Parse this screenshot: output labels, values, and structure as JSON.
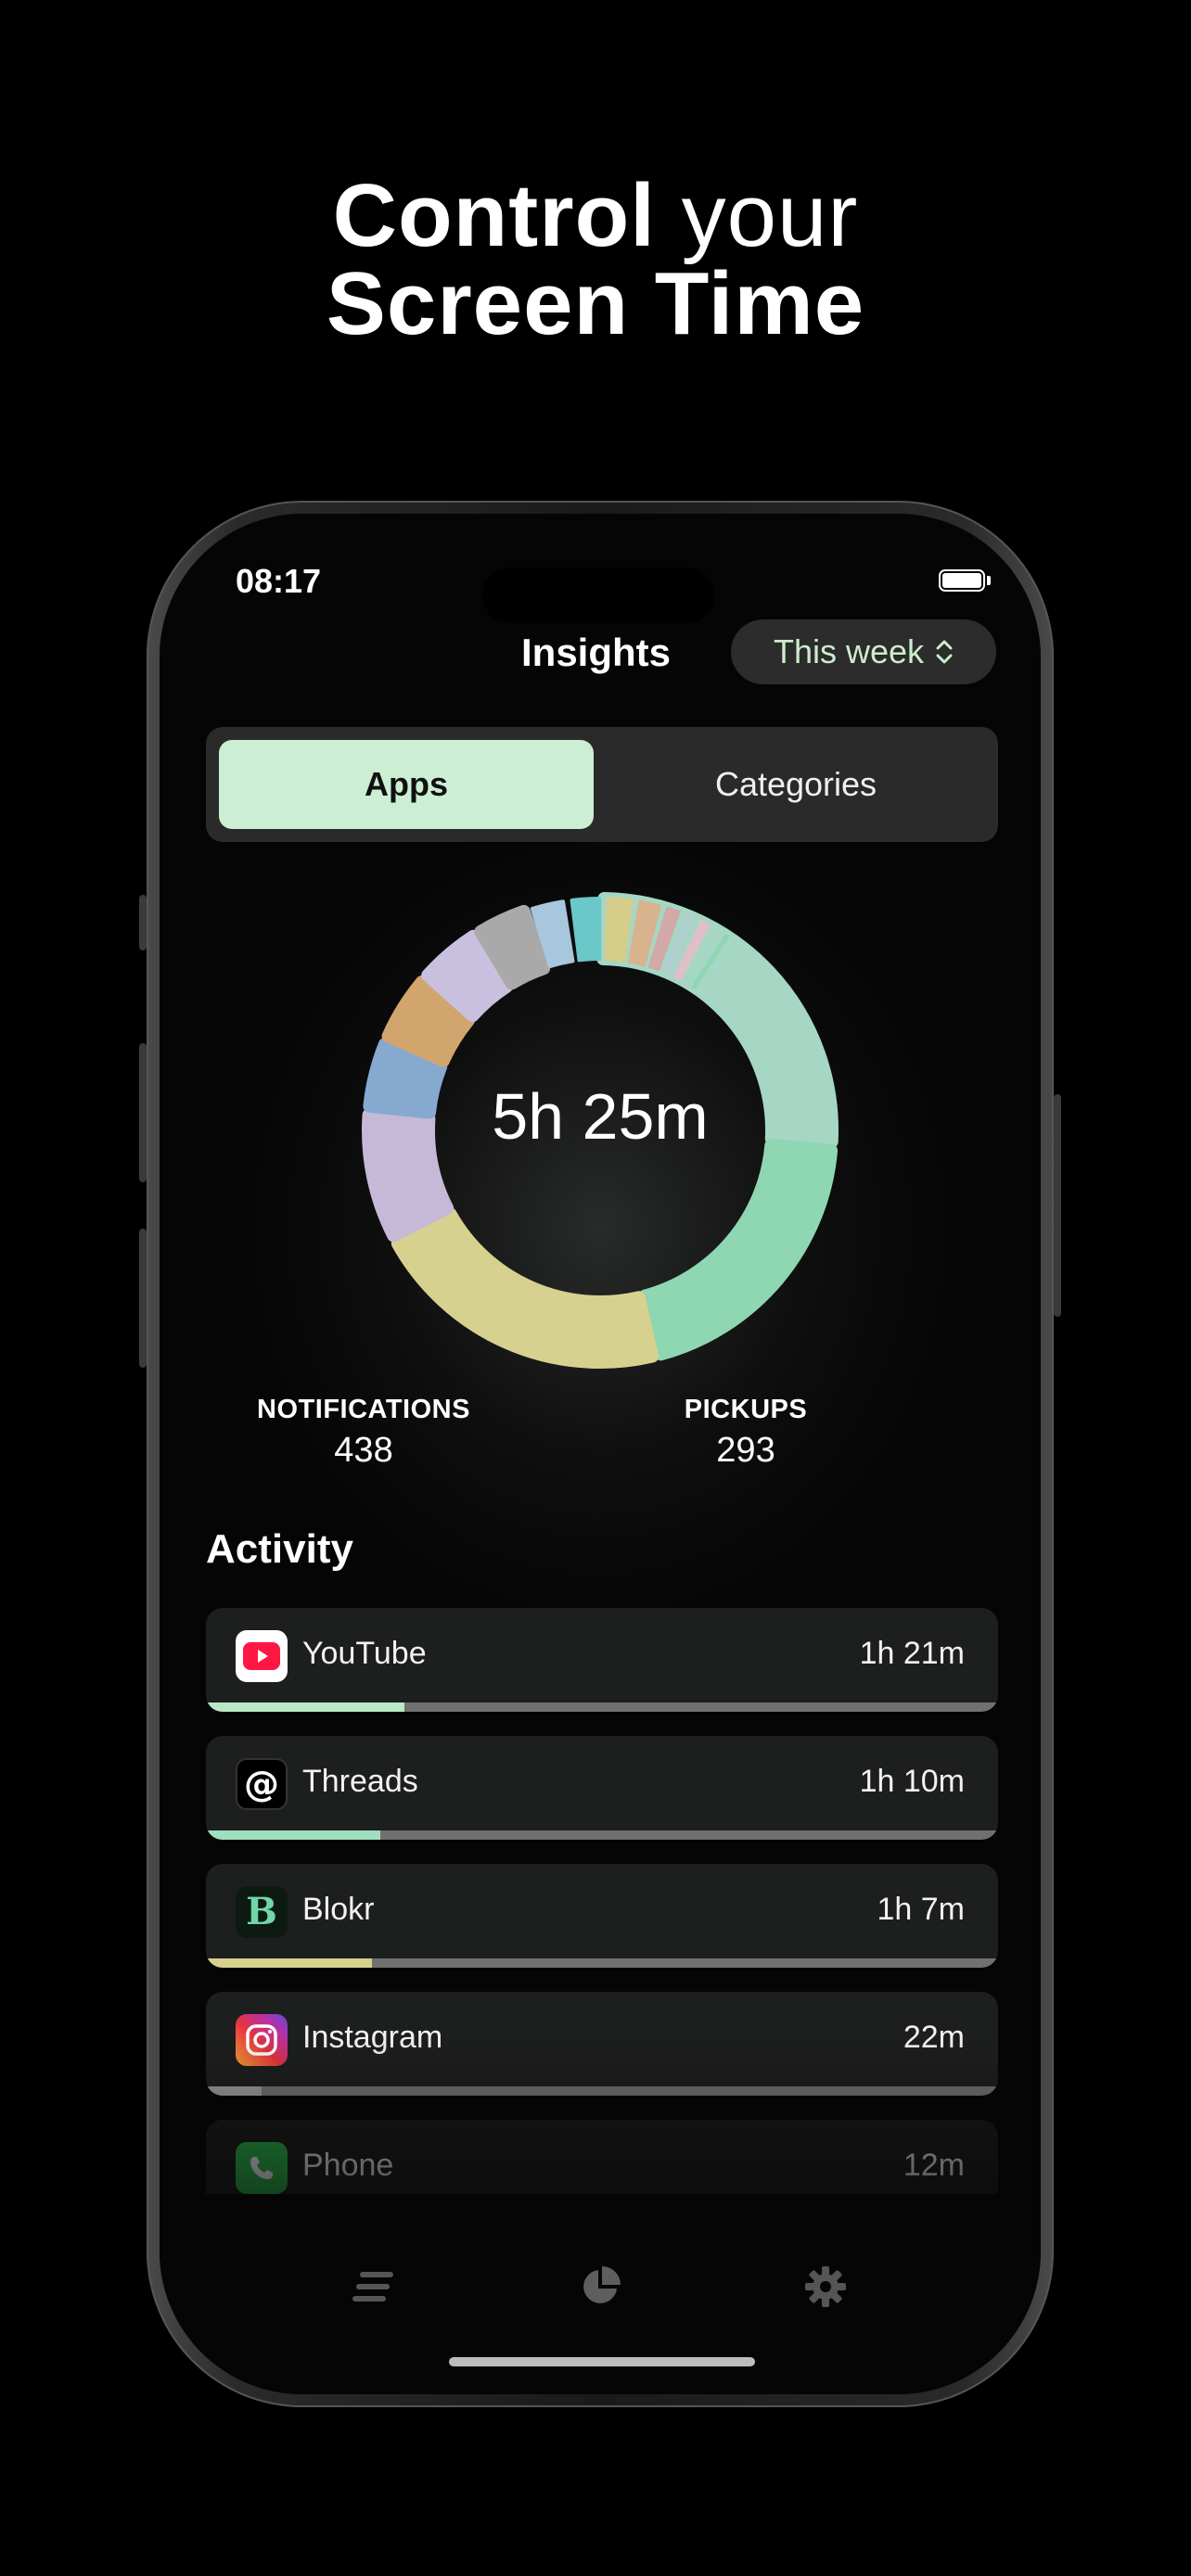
{
  "headline": {
    "line1_bold": "Control",
    "line1_light": "your",
    "line2": "Screen Time"
  },
  "status_bar": {
    "time": "08:17"
  },
  "nav": {
    "title": "Insights",
    "period": "This week"
  },
  "segmented": {
    "selected": "Apps",
    "options": [
      "Apps",
      "Categories"
    ]
  },
  "summary": {
    "total": "5h 25m",
    "notifications_label": "NOTIFICATIONS",
    "notifications_value": "438",
    "pickups_label": "PICKUPS",
    "pickups_value": "293"
  },
  "activity": {
    "title": "Activity",
    "items": [
      {
        "name": "YouTube",
        "time": "1h 21m",
        "share": 0.25,
        "bar_color": "#b9e8c7",
        "icon": "youtube-icon"
      },
      {
        "name": "Threads",
        "time": "1h 10m",
        "share": 0.22,
        "bar_color": "#9fdfbf",
        "icon": "threads-icon"
      },
      {
        "name": "Blokr",
        "time": "1h 7m",
        "share": 0.21,
        "bar_color": "#d6d18e",
        "icon": "blokr-icon"
      },
      {
        "name": "Instagram",
        "time": "22m",
        "share": 0.07,
        "bar_color": "#9a9a9a",
        "icon": "instagram-icon"
      },
      {
        "name": "Phone",
        "time": "12m",
        "share": 0.04,
        "bar_color": "#8a8a8a",
        "icon": "phone-icon"
      }
    ]
  },
  "tabs": [
    {
      "name": "list-icon"
    },
    {
      "name": "pie-chart-icon"
    },
    {
      "name": "gear-icon"
    }
  ],
  "colors": {
    "accent": "#ccefd4",
    "donut_segments": [
      "#a6d6c4",
      "#8fd6b2",
      "#d6d18e",
      "#c6b9d8",
      "#86a9cf",
      "#d2a46e",
      "#c9c0e0",
      "#a9a9a9",
      "#a8c6de",
      "#6bc8c8",
      "#d6cd8a",
      "#d8b48e",
      "#d2a8a8",
      "#b0d0d0",
      "#e0c0c8"
    ]
  }
}
